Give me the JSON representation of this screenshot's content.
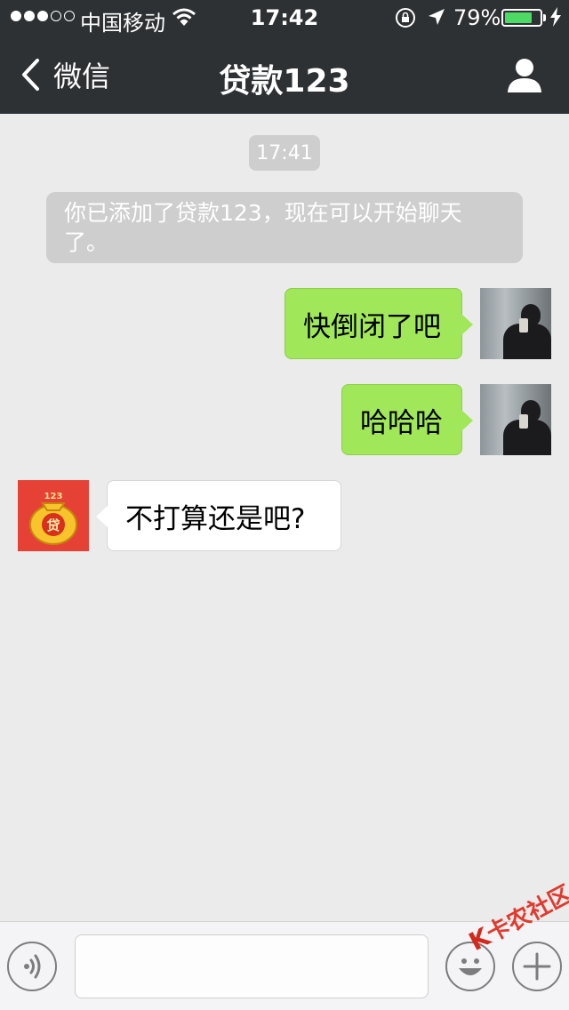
{
  "status_bar": {
    "carrier": "中国移动",
    "time": "17:42",
    "battery_percent": "79%",
    "battery_level": 0.79,
    "signal_bars_on": 3,
    "signal_bars_total": 5
  },
  "nav": {
    "back_label": "微信",
    "title": "贷款123",
    "back_icon": "chevron-left-icon",
    "profile_icon": "person-icon"
  },
  "chat": {
    "timestamp": "17:41",
    "system_message": "你已添加了贷款123，现在可以开始聊天了。",
    "messages": [
      {
        "sender": "me",
        "text": "快倒闭了吧"
      },
      {
        "sender": "me",
        "text": "哈哈哈"
      },
      {
        "sender": "contact",
        "text": "不打算还是吧?"
      }
    ]
  },
  "bot_avatar": {
    "glyph": "贷",
    "coin_text": "123"
  },
  "input_bar": {
    "text_value": "",
    "voice_icon": "voice-icon",
    "emoji_icon": "emoji-icon",
    "plus_icon": "plus-icon"
  },
  "watermark": {
    "text": "卡农社区",
    "mark": "K"
  },
  "colors": {
    "nav_background": "#2e3134",
    "chat_background": "#ebebeb",
    "my_bubble": "#a0e75a",
    "their_bubble": "#ffffff",
    "battery_fill": "#4cd964"
  }
}
